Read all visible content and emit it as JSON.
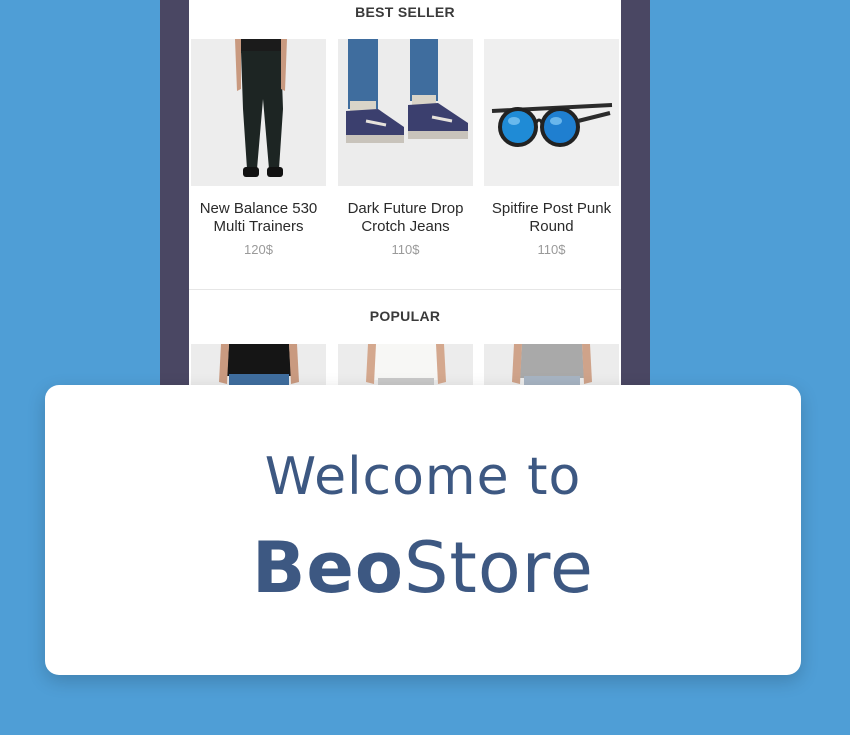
{
  "best_seller": {
    "title": "BEST SELLER",
    "products": [
      {
        "name": "New Balance 530 Multi Trainers",
        "price": "120$",
        "image": "black-jeans-model"
      },
      {
        "name": "Dark Future Drop Crotch Jeans",
        "price": "110$",
        "image": "jeans-sneakers"
      },
      {
        "name": "Spitfire Post Punk Round",
        "price": "110$",
        "image": "blue-mirror-sunglasses"
      }
    ]
  },
  "popular": {
    "title": "POPULAR",
    "products": [
      {
        "image": "black-tshirt-model"
      },
      {
        "image": "white-tshirt-model"
      },
      {
        "image": "grey-tshirt-model"
      }
    ]
  },
  "welcome_card": {
    "line1": "Welcome to",
    "brand_bold": "Beo",
    "brand_light": "Store"
  },
  "colors": {
    "background": "#4f9ed6",
    "phone_frame": "#4a4763",
    "brand": "#3d5882"
  }
}
